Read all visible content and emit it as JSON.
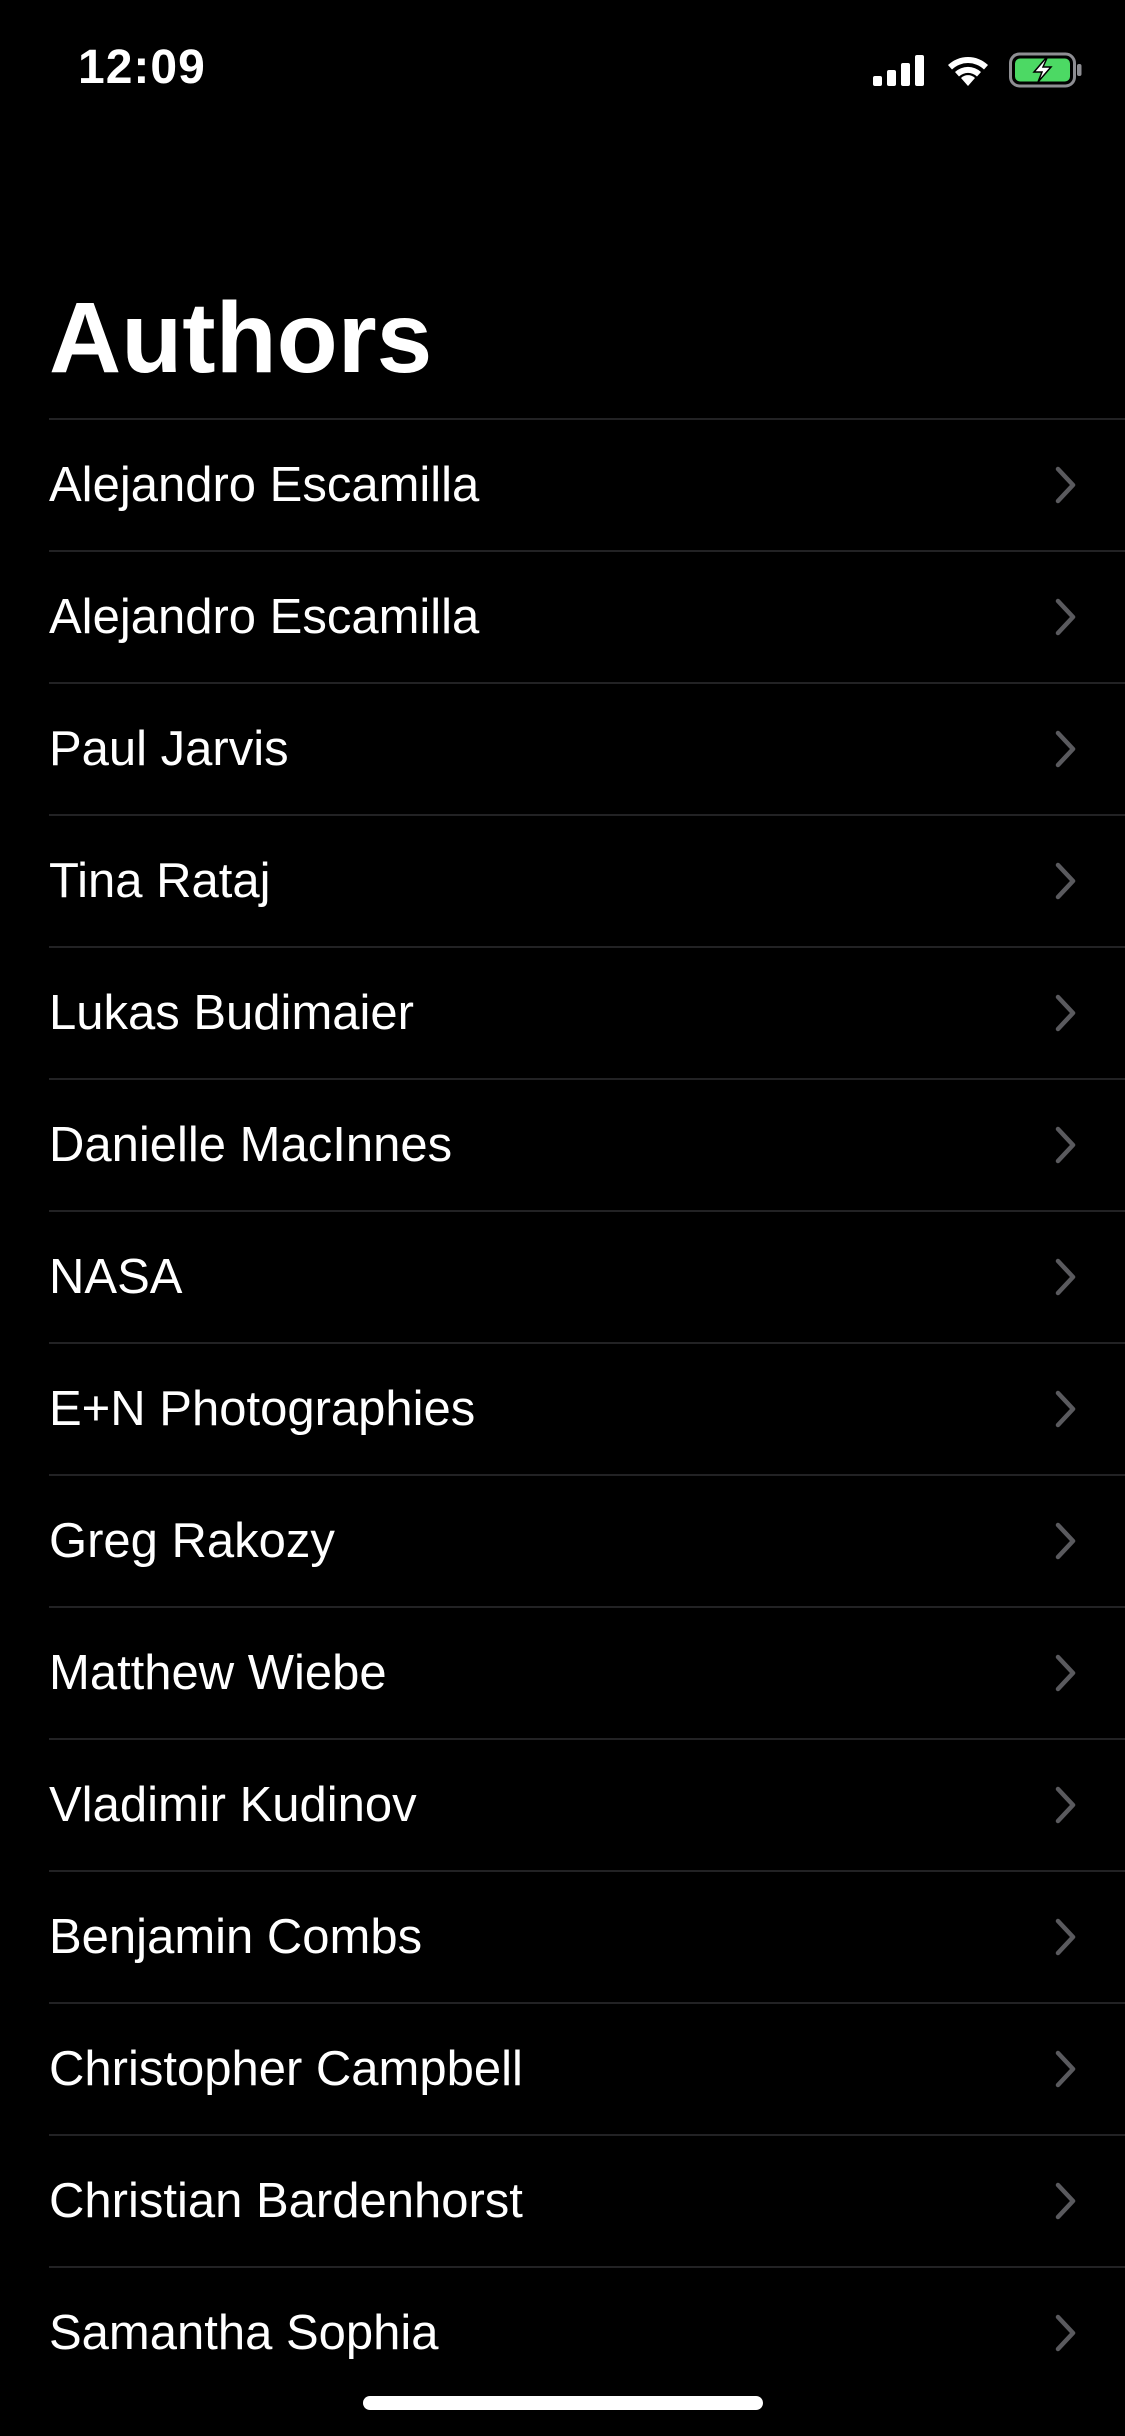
{
  "status_bar": {
    "time": "12:09",
    "icons": [
      "cellular-signal-icon",
      "wifi-icon",
      "battery-charging-icon"
    ],
    "battery_color": "#4cd964"
  },
  "header": {
    "title": "Authors"
  },
  "authors": [
    {
      "name": "Alejandro Escamilla"
    },
    {
      "name": "Alejandro Escamilla"
    },
    {
      "name": "Paul Jarvis"
    },
    {
      "name": "Tina Rataj"
    },
    {
      "name": "Lukas Budimaier"
    },
    {
      "name": "Danielle MacInnes"
    },
    {
      "name": "NASA"
    },
    {
      "name": "E+N Photographies"
    },
    {
      "name": "Greg Rakozy"
    },
    {
      "name": "Matthew Wiebe"
    },
    {
      "name": "Vladimir Kudinov"
    },
    {
      "name": "Benjamin Combs"
    },
    {
      "name": "Christopher Campbell"
    },
    {
      "name": "Christian Bardenhorst"
    },
    {
      "name": "Samantha Sophia"
    }
  ],
  "row_icon": "chevron-right-icon",
  "colors": {
    "background": "#000000",
    "text": "#ffffff",
    "separator": "#222224",
    "chevron": "#5a5a5e"
  }
}
